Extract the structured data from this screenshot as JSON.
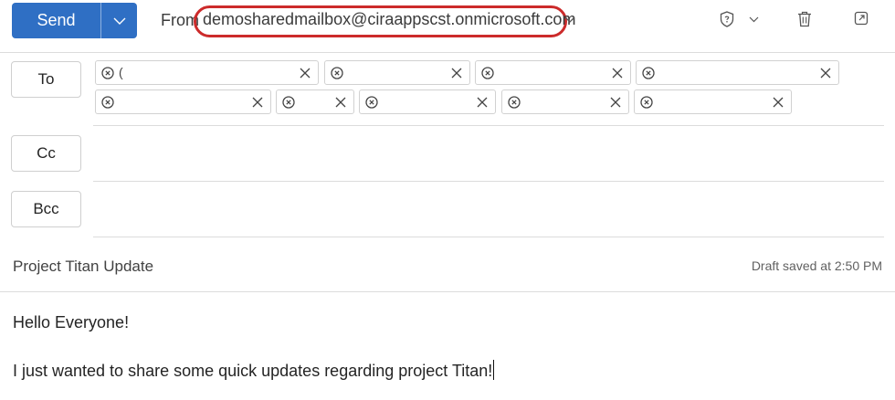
{
  "toolbar": {
    "send_label": "Send",
    "from_label": "From",
    "from_address": "demosharedmailbox@ciraappscst.onmicrosoft.com"
  },
  "recipients": {
    "to_label": "To",
    "cc_label": "Cc",
    "bcc_label": "Bcc",
    "to_chips": [
      "(",
      "",
      "",
      "",
      "",
      "",
      "",
      "",
      ""
    ]
  },
  "subject": {
    "text": "Project Titan Update",
    "status": "Draft saved at 2:50 PM"
  },
  "body": {
    "greeting": "Hello Everyone!",
    "line1": "I just wanted to share some quick updates regarding project Titan!"
  },
  "colors": {
    "accent": "#2f6fc4",
    "highlight": "#cc2b2b"
  },
  "icons": [
    "chevron-down-icon",
    "shield-question-icon",
    "trash-icon",
    "pop-out-icon",
    "remove-recipient-icon",
    "close-icon"
  ]
}
